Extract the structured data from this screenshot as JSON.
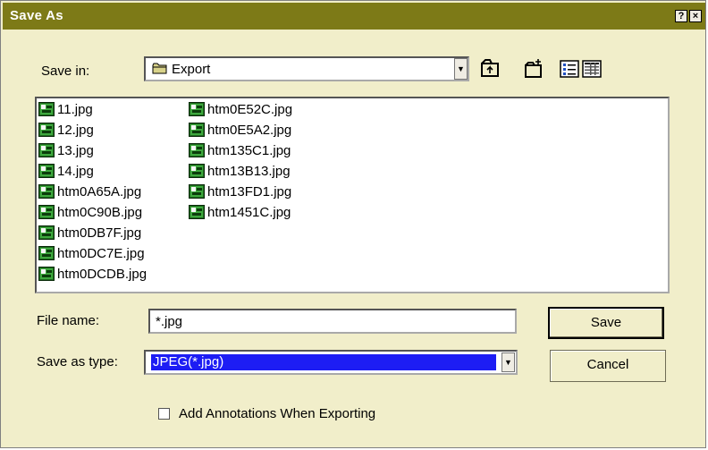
{
  "dialog": {
    "title": "Save As"
  },
  "titlebar": {
    "help_label": "?",
    "close_label": "×"
  },
  "lookin": {
    "label": "Save in:",
    "value": "Export"
  },
  "files": {
    "col1": [
      "11.jpg",
      "12.jpg",
      "13.jpg",
      "14.jpg",
      "htm0A65A.jpg",
      "htm0C90B.jpg",
      "htm0DB7F.jpg",
      "htm0DC7E.jpg",
      "htm0DCDB.jpg"
    ],
    "col2": [
      "htm0E52C.jpg",
      "htm0E5A2.jpg",
      "htm135C1.jpg",
      "htm13B13.jpg",
      "htm13FD1.jpg",
      "htm1451C.jpg"
    ]
  },
  "filename": {
    "label": "File name:",
    "value": "*.jpg"
  },
  "savetype": {
    "label": "Save as type:",
    "value": "JPEG(*.jpg)"
  },
  "buttons": {
    "save": "Save",
    "cancel": "Cancel"
  },
  "annotations": {
    "label": "Add Annotations When Exporting",
    "checked": false
  },
  "colors": {
    "titlebar": "#7d7a17",
    "dialog_bg": "#f1eeca",
    "selection": "#1d1df4"
  }
}
